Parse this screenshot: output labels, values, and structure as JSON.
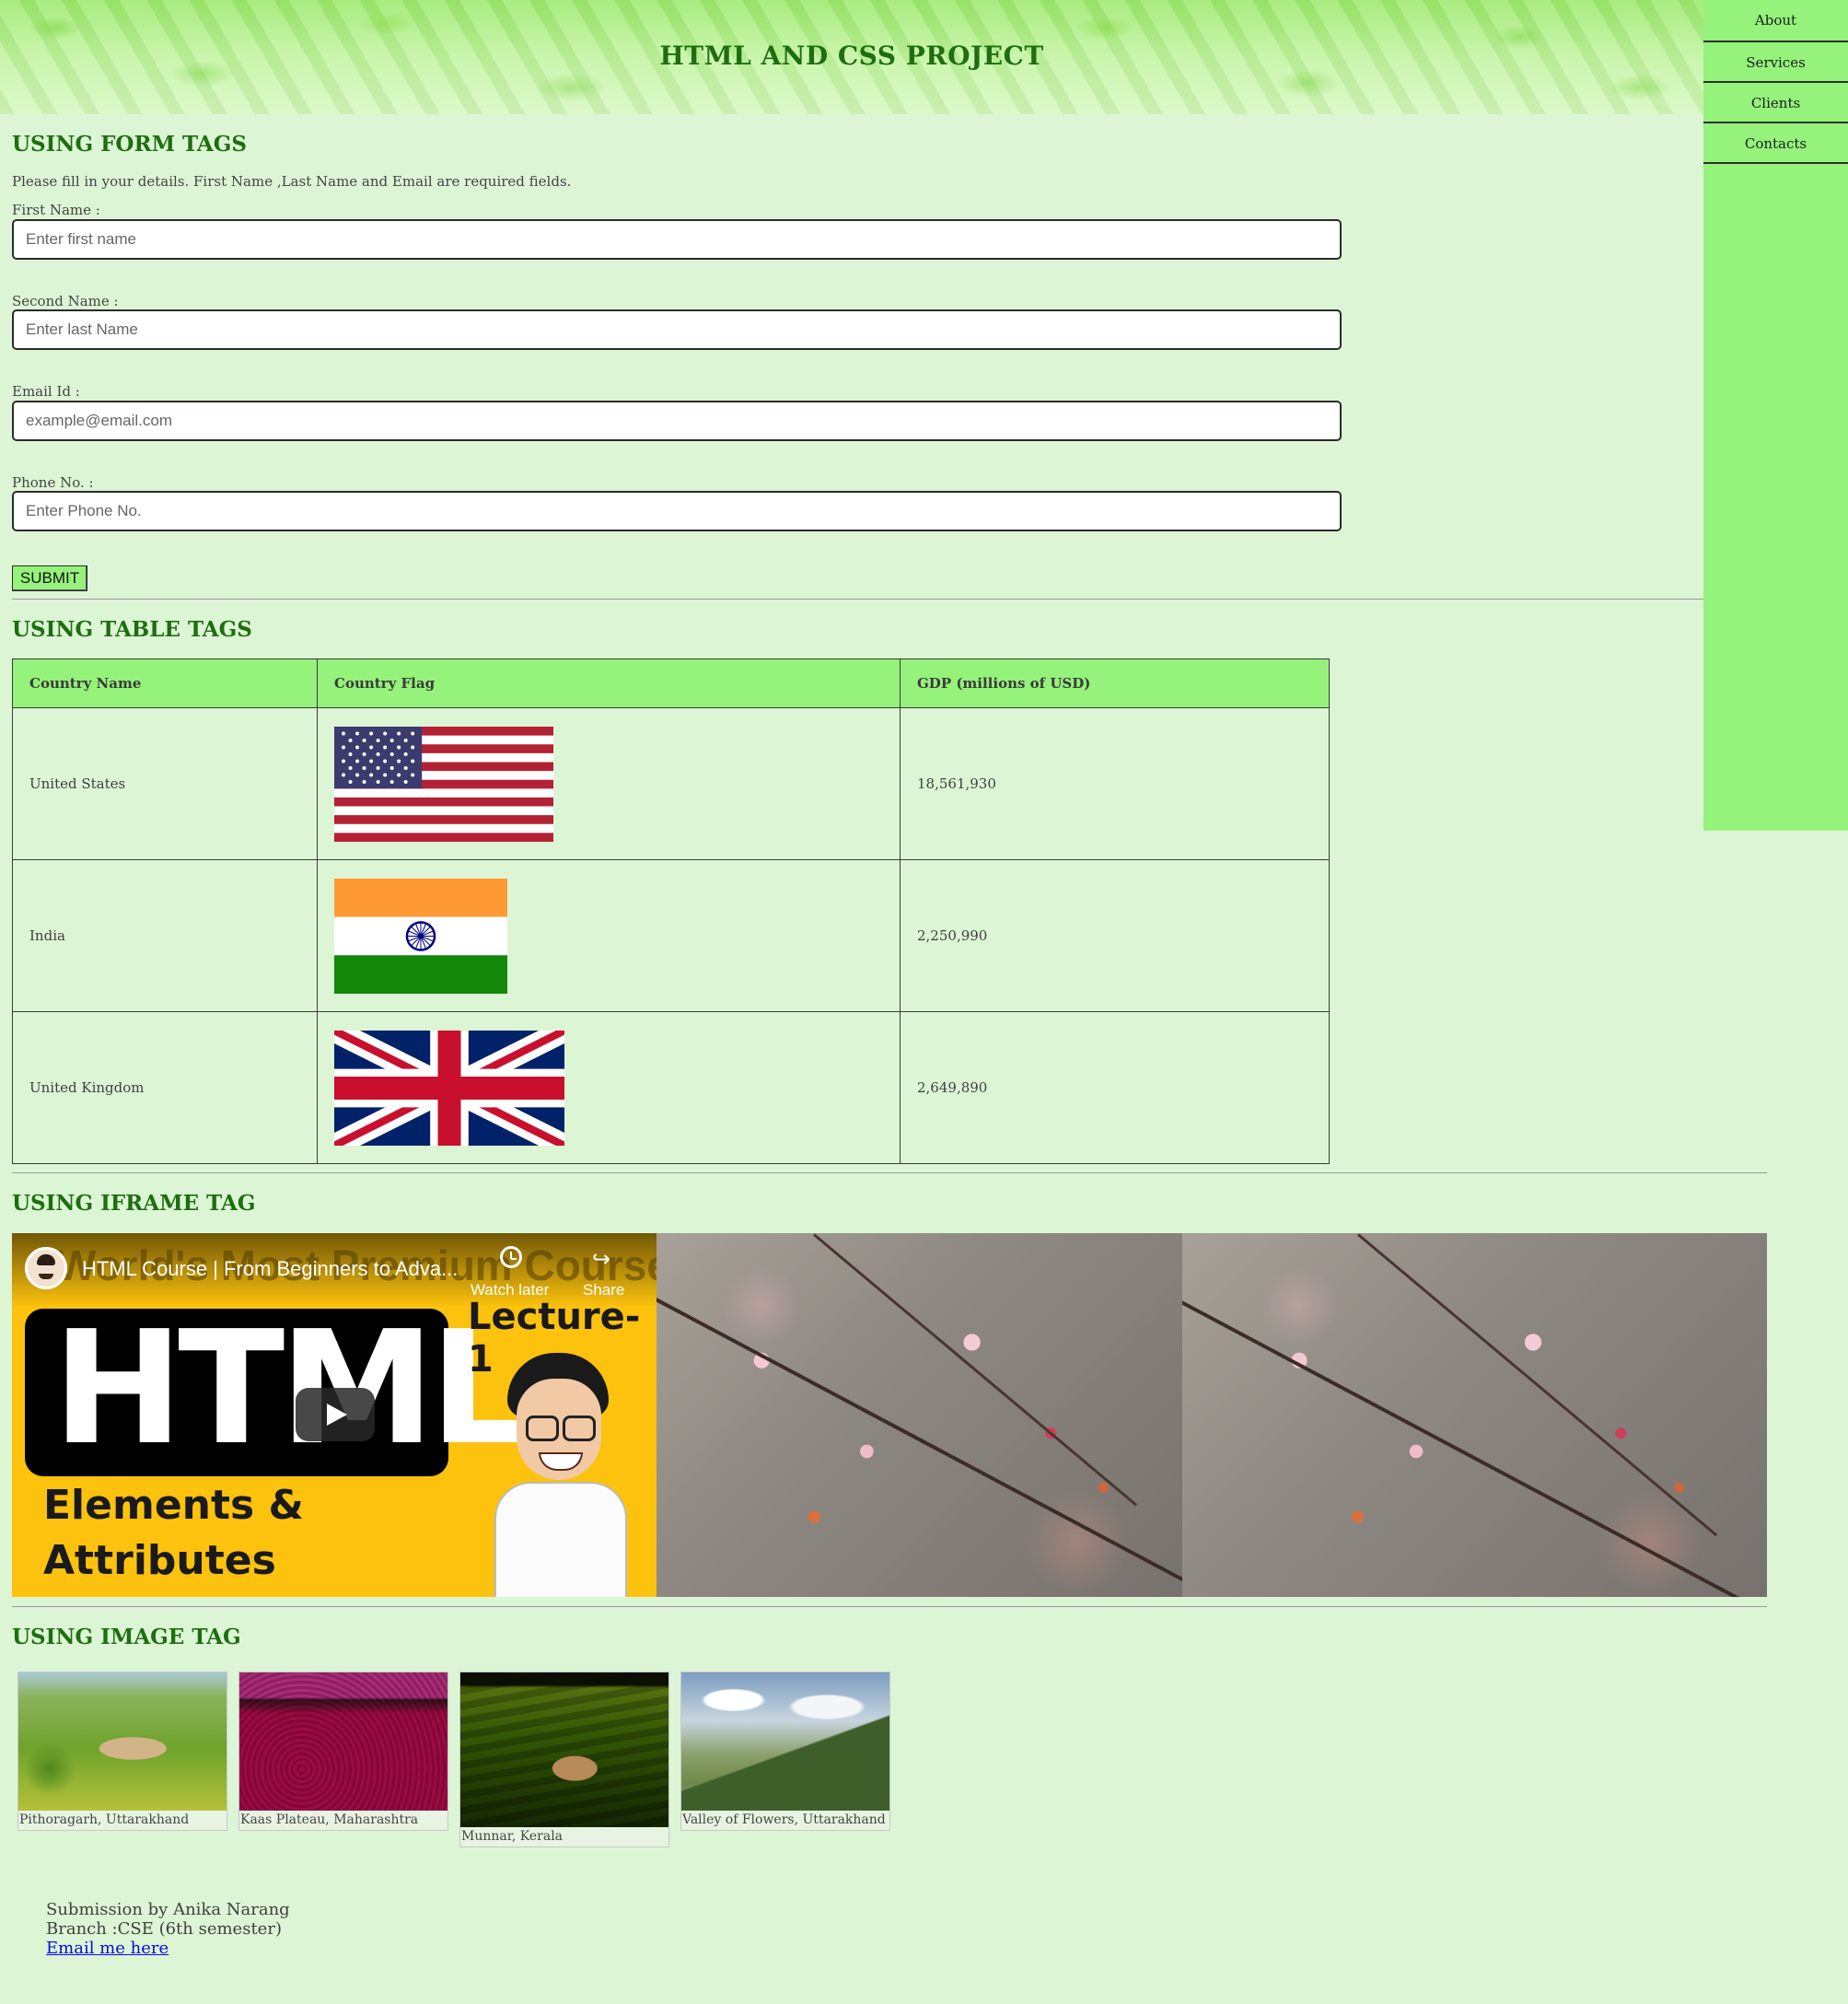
{
  "header": {
    "title": "HTML AND CSS PROJECT"
  },
  "nav": {
    "items": [
      {
        "label": "About"
      },
      {
        "label": "Services"
      },
      {
        "label": "Clients"
      },
      {
        "label": "Contacts"
      }
    ]
  },
  "form": {
    "heading": "USING FORM TAGS",
    "note": "Please fill in your details. First Name ,Last Name and Email are required fields.",
    "fields": [
      {
        "label": "First Name :",
        "placeholder": "Enter first name",
        "value": ""
      },
      {
        "label": "Second Name :",
        "placeholder": "Enter last Name",
        "value": ""
      },
      {
        "label": "Email Id :",
        "placeholder": "example@email.com",
        "value": ""
      },
      {
        "label": "Phone No. :",
        "placeholder": "Enter Phone No.",
        "value": ""
      }
    ],
    "submit_label": "SUBMIT"
  },
  "table": {
    "heading": "USING TABLE TAGS",
    "columns": [
      "Country Name",
      "Country Flag",
      "GDP (millions of USD)"
    ],
    "rows": [
      {
        "country": "United States",
        "flag": "us-flag",
        "gdp": "18,561,930"
      },
      {
        "country": "India",
        "flag": "india-flag",
        "gdp": "2,250,990"
      },
      {
        "country": "United Kingdom",
        "flag": "uk-flag",
        "gdp": "2,649,890"
      }
    ]
  },
  "iframe": {
    "heading": "USING IFRAME TAG",
    "video": {
      "title": "HTML Course | From Beginners to Adva...",
      "banner": "World's Most Premium Course on",
      "watch_later": "Watch later",
      "share": "Share",
      "big_text": "HTML",
      "lecture": "Lecture-1",
      "subtitle_line1": "Elements &",
      "subtitle_line2": "Attributes"
    }
  },
  "images": {
    "heading": "USING IMAGE TAG",
    "items": [
      {
        "caption": "Pithoragarh, Uttarakhand"
      },
      {
        "caption": "Kaas Plateau, Maharashtra"
      },
      {
        "caption": "Munnar, Kerala"
      },
      {
        "caption": "Valley of Flowers, Uttarakhand"
      }
    ]
  },
  "footer": {
    "line1": "Submission by Anika Narang",
    "line2": "Branch :CSE (6th semester)",
    "email_link": "Email me here"
  },
  "colors": {
    "accent": "#95f27b",
    "heading": "#1e6e0f",
    "background": "#dcf5d5"
  }
}
